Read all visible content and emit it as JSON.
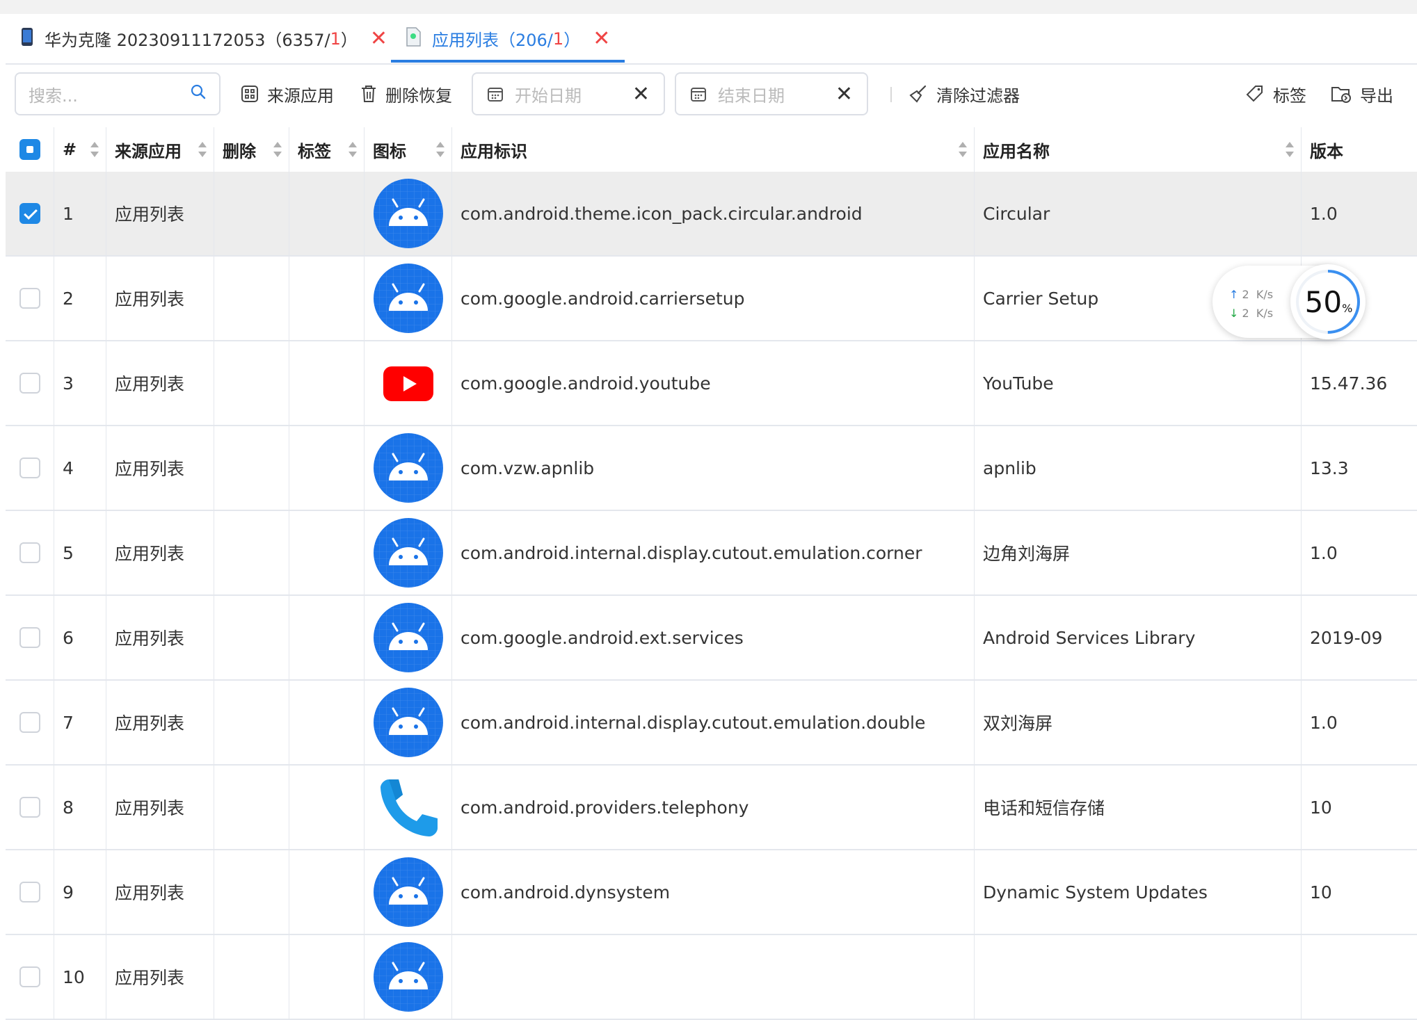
{
  "tabs": [
    {
      "icon": "phone-icon",
      "title": "华为克隆 20230911172053（6357/",
      "red": "1",
      "close": "）",
      "active": false
    },
    {
      "icon": "file-icon",
      "title": "应用列表（206/",
      "red": "1",
      "close": "）",
      "active": true
    }
  ],
  "toolbar": {
    "search_placeholder": "搜索...",
    "source_app": "来源应用",
    "delete_restore": "删除恢复",
    "start_date": "开始日期",
    "end_date": "结束日期",
    "clear_filter": "清除过滤器",
    "tag": "标签",
    "export": "导出"
  },
  "columns": [
    "#",
    "来源应用",
    "删除",
    "标签",
    "图标",
    "应用标识",
    "应用名称",
    "版本"
  ],
  "rows": [
    {
      "n": "1",
      "src": "应用列表",
      "id": "com.android.theme.icon_pack.circular.android",
      "name": "Circular",
      "ver": "1.0",
      "icon": "android-icon",
      "checked": true
    },
    {
      "n": "2",
      "src": "应用列表",
      "id": "com.google.android.carriersetup",
      "name": "Carrier Setup",
      "ver": "",
      "icon": "android-icon",
      "checked": false
    },
    {
      "n": "3",
      "src": "应用列表",
      "id": "com.google.android.youtube",
      "name": "YouTube",
      "ver": "15.47.36",
      "icon": "youtube-icon",
      "checked": false
    },
    {
      "n": "4",
      "src": "应用列表",
      "id": "com.vzw.apnlib",
      "name": "apnlib",
      "ver": "13.3",
      "icon": "android-icon",
      "checked": false
    },
    {
      "n": "5",
      "src": "应用列表",
      "id": "com.android.internal.display.cutout.emulation.corner",
      "name": "边角刘海屏",
      "ver": "1.0",
      "icon": "android-icon",
      "checked": false
    },
    {
      "n": "6",
      "src": "应用列表",
      "id": "com.google.android.ext.services",
      "name": "Android Services Library",
      "ver": "2019-09",
      "icon": "android-icon",
      "checked": false
    },
    {
      "n": "7",
      "src": "应用列表",
      "id": "com.android.internal.display.cutout.emulation.double",
      "name": "双刘海屏",
      "ver": "1.0",
      "icon": "android-icon",
      "checked": false
    },
    {
      "n": "8",
      "src": "应用列表",
      "id": "com.android.providers.telephony",
      "name": "电话和短信存储",
      "ver": "10",
      "icon": "phone-handset-icon",
      "checked": false
    },
    {
      "n": "9",
      "src": "应用列表",
      "id": "com.android.dynsystem",
      "name": "Dynamic System Updates",
      "ver": "10",
      "icon": "android-icon",
      "checked": false
    },
    {
      "n": "10",
      "src": "应用列表",
      "id": "",
      "name": "",
      "ver": "",
      "icon": "android-icon",
      "checked": false
    }
  ],
  "speed": {
    "up": "2",
    "down": "2",
    "unit": "K/s",
    "percent": "50",
    "percent_sign": "%",
    "progress": 0.5
  },
  "colors": {
    "accent": "#2a7de1",
    "red": "#ef4444",
    "android_bg": "#1a73e8",
    "youtube": "#ff0000"
  }
}
